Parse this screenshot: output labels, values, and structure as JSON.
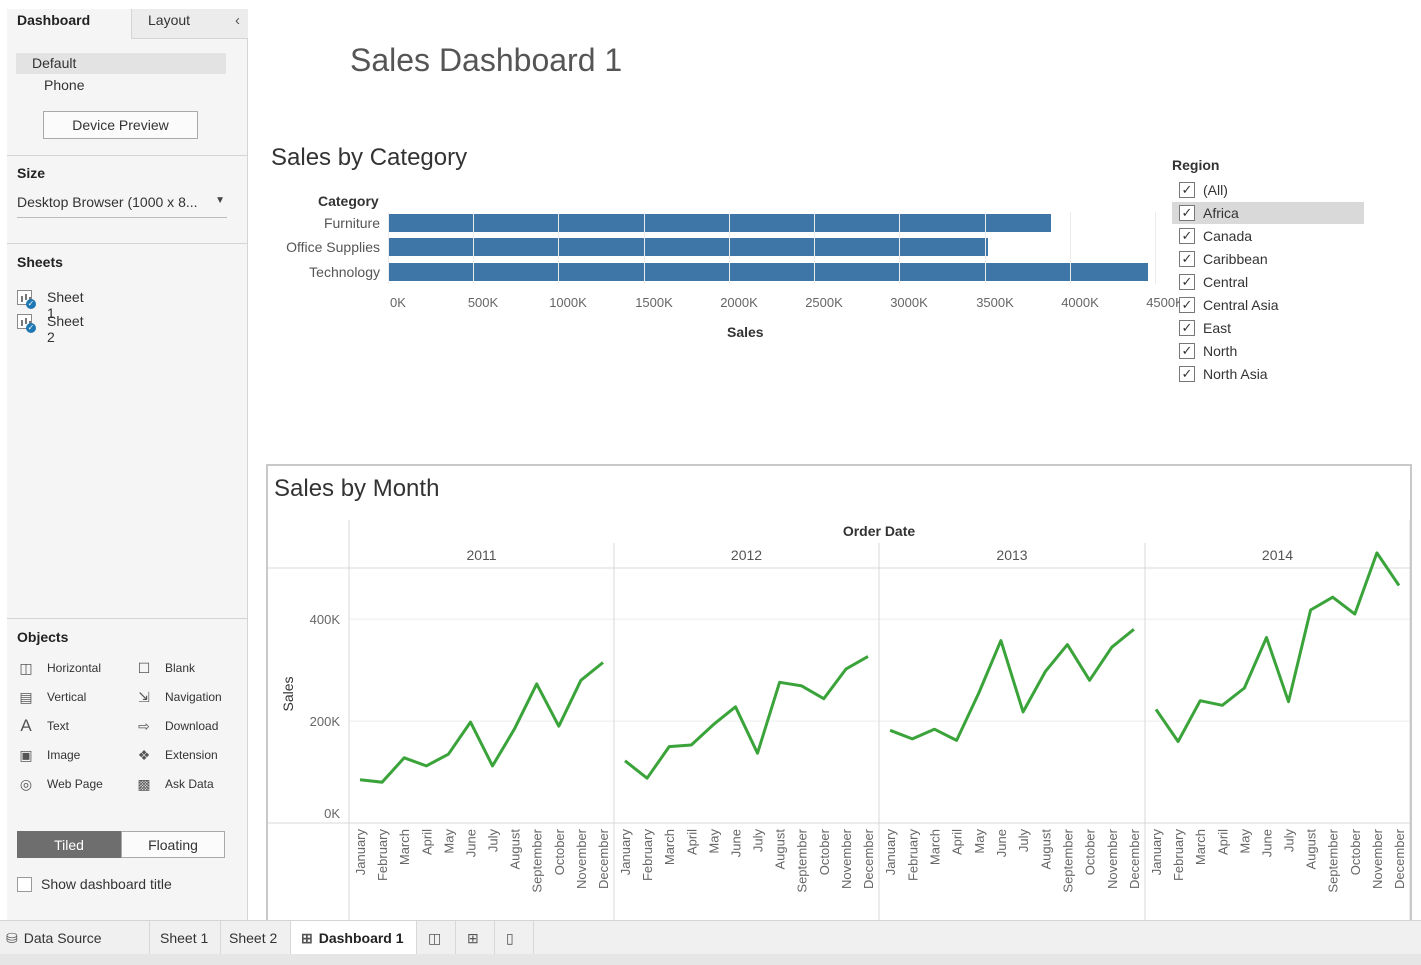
{
  "left_panel": {
    "tabs": {
      "dashboard": "Dashboard",
      "layout": "Layout"
    },
    "device": {
      "default": "Default",
      "phone": "Phone",
      "preview_button": "Device Preview"
    },
    "size": {
      "title": "Size",
      "value": "Desktop Browser (1000 x 8..."
    },
    "sheets": {
      "title": "Sheets",
      "items": [
        "Sheet 1",
        "Sheet 2"
      ]
    },
    "objects": {
      "title": "Objects",
      "items": [
        {
          "label": "Horizontal",
          "icon": "horizontal-icon"
        },
        {
          "label": "Blank",
          "icon": "blank-icon"
        },
        {
          "label": "Vertical",
          "icon": "vertical-icon"
        },
        {
          "label": "Navigation",
          "icon": "navigation-icon"
        },
        {
          "label": "Text",
          "icon": "text-icon"
        },
        {
          "label": "Download",
          "icon": "download-icon"
        },
        {
          "label": "Image",
          "icon": "image-icon"
        },
        {
          "label": "Extension",
          "icon": "extension-icon"
        },
        {
          "label": "Web Page",
          "icon": "web-page-icon"
        },
        {
          "label": "Ask Data",
          "icon": "ask-data-icon"
        }
      ]
    },
    "tiled": "Tiled",
    "floating": "Floating",
    "show_title": "Show dashboard title"
  },
  "dashboard": {
    "title": "Sales Dashboard 1"
  },
  "region_filter": {
    "title": "Region",
    "items": [
      "(All)",
      "Africa",
      "Canada",
      "Caribbean",
      "Central",
      "Central Asia",
      "East",
      "North",
      "North Asia"
    ],
    "selected": "Africa"
  },
  "bottom_tabs": {
    "data_source": "Data Source",
    "sheet1": "Sheet 1",
    "sheet2": "Sheet 2",
    "dashboard1": "Dashboard 1"
  },
  "colors": {
    "bar": "#3f76a8",
    "line": "#3aa33a",
    "accent": "#1f77b4"
  },
  "chart_data": [
    {
      "type": "bar",
      "title": "Sales by Category",
      "category_header": "Category",
      "categories": [
        "Furniture",
        "Office Supplies",
        "Technology"
      ],
      "values": [
        3890000,
        3520000,
        4460000
      ],
      "xlabel": "Sales",
      "xlim": [
        0,
        4700000
      ],
      "xticks": [
        "0K",
        "500K",
        "1000K",
        "1500K",
        "2000K",
        "2500K",
        "3000K",
        "3500K",
        "4000K",
        "4500K"
      ],
      "xtick_values": [
        0,
        500000,
        1000000,
        1500000,
        2000000,
        2500000,
        3000000,
        3500000,
        4000000,
        4500000
      ]
    },
    {
      "type": "line",
      "title": "Sales by Month",
      "xlabel": "Order Date",
      "ylabel": "Sales",
      "ylim": [
        0,
        520000
      ],
      "yticks": [
        "0K",
        "200K",
        "400K"
      ],
      "ytick_values": [
        0,
        200000,
        400000
      ],
      "months": [
        "January",
        "February",
        "March",
        "April",
        "May",
        "June",
        "July",
        "August",
        "September",
        "October",
        "November",
        "December"
      ],
      "panels": [
        {
          "year": "2011",
          "values": [
            85000,
            80000,
            128000,
            112000,
            135000,
            198000,
            112000,
            185000,
            273000,
            190000,
            280000,
            315000
          ]
        },
        {
          "year": "2012",
          "values": [
            122000,
            88000,
            150000,
            153000,
            193000,
            228000,
            137000,
            276000,
            269000,
            244000,
            302000,
            327000
          ]
        },
        {
          "year": "2013",
          "values": [
            182000,
            165000,
            184000,
            162000,
            255000,
            358000,
            218000,
            297000,
            350000,
            280000,
            345000,
            380000
          ]
        },
        {
          "year": "2014",
          "values": [
            223000,
            160000,
            240000,
            231000,
            265000,
            364000,
            238000,
            418000,
            443000,
            410000,
            530000,
            466000
          ]
        }
      ]
    }
  ]
}
